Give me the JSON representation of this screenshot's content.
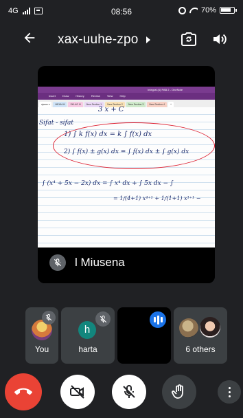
{
  "status_bar": {
    "network": "4G",
    "time": "08:56",
    "battery": "70%"
  },
  "header": {
    "meeting_code": "xax-uuhe-zpo",
    "icons": [
      "back-arrow-icon",
      "caret-right-icon",
      "switch-camera-icon",
      "speaker-icon"
    ]
  },
  "presentation": {
    "presenter_name": "l Miusena",
    "onenote": {
      "doc_title": "Integral (4) PAB 2 - OneNote",
      "menu": [
        "Insert",
        "Draw",
        "History",
        "Review",
        "View",
        "Help"
      ],
      "tabs": [
        {
          "label": "ajaran ▾",
          "color": "#ffffff"
        },
        {
          "label": "MEAN M",
          "color": "#cfe3f7"
        },
        {
          "label": "SKLAS III",
          "color": "#f7c9e3"
        },
        {
          "label": "New Section 1",
          "color": "#e9d7f5"
        },
        {
          "label": "New Section 2",
          "color": "#f9e1b6"
        },
        {
          "label": "New Section 3",
          "color": "#cfeacb"
        },
        {
          "label": "New Section 4",
          "color": "#f7d0c4"
        },
        {
          "label": "+",
          "color": "#ffffff"
        }
      ],
      "handwriting": {
        "top_fragment": "3  x  + C",
        "sifat_label": "Sifat - sifat",
        "rule_1": "1)  ∫ k f(x) dx  =  k ∫ f(x) dx",
        "rule_2": "2)  ∫ f(x) ± g(x) dx  =  ∫ f(x) dx  ±  ∫ g(x) dx",
        "example": "∫ (x⁴ + 5x − 2x) dx  =  ∫ x⁴ dx  +  ∫ 5x dx  −  ∫",
        "example_2": "=  1/(4+1) x⁴⁺¹  +  1/(1+1) x¹⁺¹  −"
      }
    }
  },
  "participants": [
    {
      "name": "You",
      "mic": "muted"
    },
    {
      "name": "harta",
      "initial": "h",
      "mic": "muted",
      "avatar_color": "#12867d"
    },
    {
      "name": "",
      "state": "speaking"
    },
    {
      "name": "6 others"
    }
  ],
  "controls": {
    "buttons": [
      "end-call",
      "camera-off",
      "mic-off",
      "raise-hand",
      "more-options"
    ],
    "colors": {
      "end_call": "#ea4335",
      "speaking_accent": "#1a73e8"
    }
  }
}
